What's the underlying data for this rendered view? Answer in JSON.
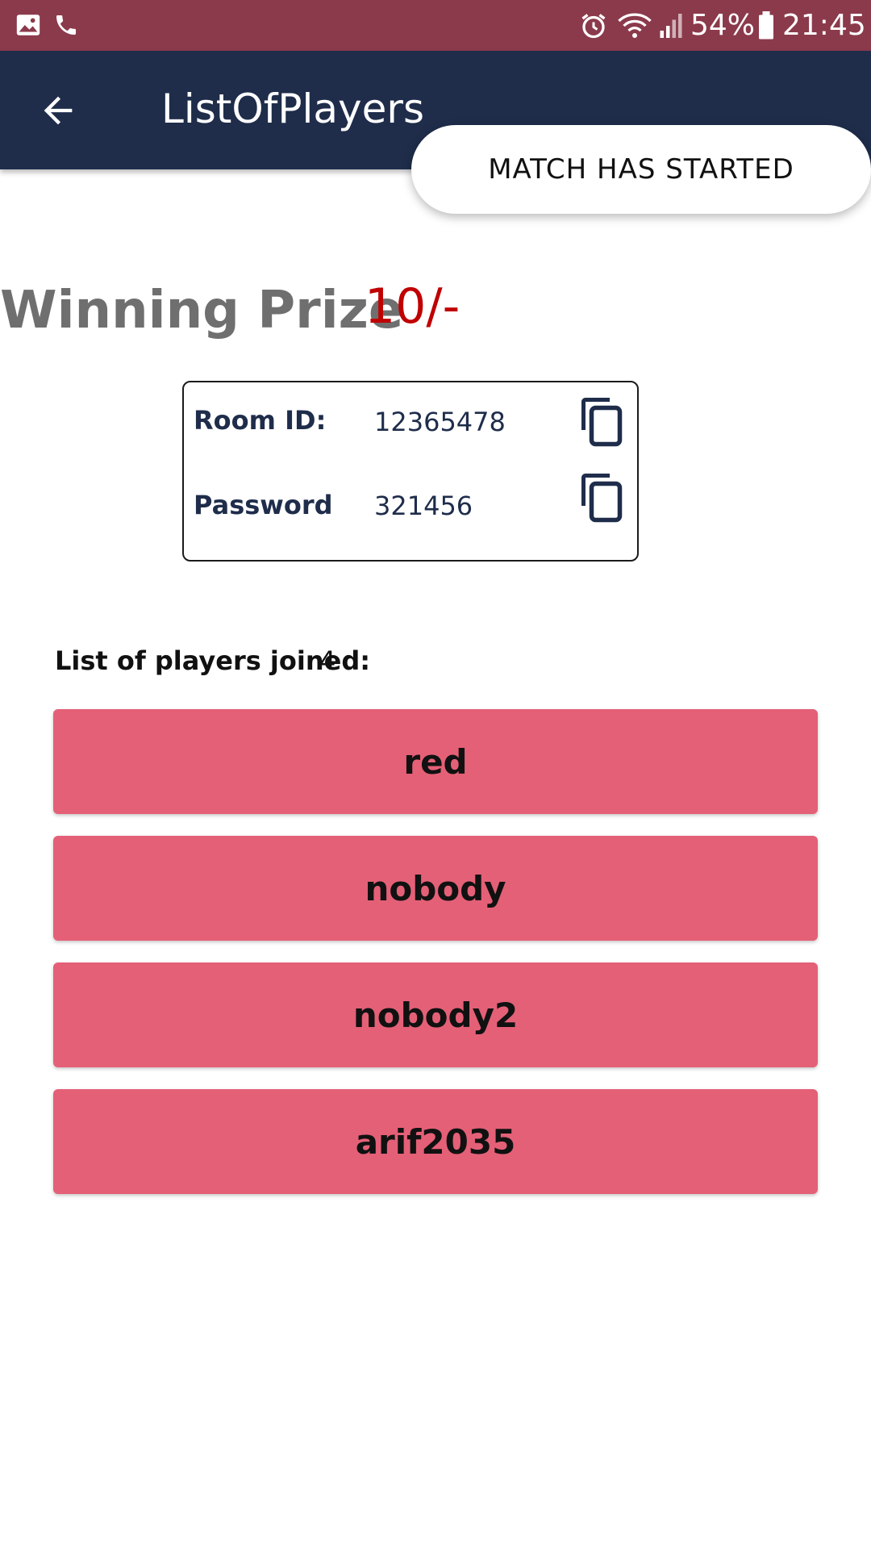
{
  "status_bar": {
    "battery": "54%",
    "time": "21:45",
    "icons": [
      "gallery-icon",
      "phone-icon",
      "alarm-icon",
      "wifi-icon",
      "signal-icon",
      "battery-icon"
    ],
    "color": "#8b3a4b"
  },
  "app_bar": {
    "title": "ListOfPlayers",
    "back_icon": "arrow-back-icon",
    "color": "#1f2d4b"
  },
  "toast": {
    "message": "MATCH HAS STARTED"
  },
  "prize": {
    "label": "Winning Prize",
    "value": "10/-",
    "value_color": "#c00000"
  },
  "room": {
    "id_label": "Room ID:",
    "id_value": "12365478",
    "password_label": "Password",
    "password_value": "321456",
    "copy_icon": "copy-icon"
  },
  "players": {
    "heading": "List of players joined:",
    "count": "4",
    "row_color": "#e46077",
    "items": [
      {
        "name": "red"
      },
      {
        "name": "nobody"
      },
      {
        "name": "nobody2"
      },
      {
        "name": "arif2035"
      }
    ]
  }
}
